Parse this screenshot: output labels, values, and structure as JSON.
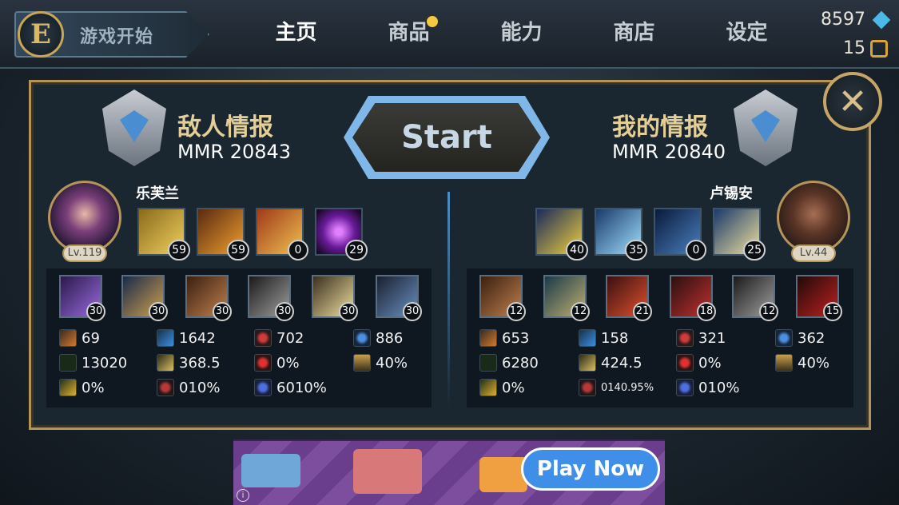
{
  "topbar": {
    "logo_letter": "E",
    "game_start_label": "游戏开始",
    "tabs": [
      {
        "label": "主页",
        "active": true
      },
      {
        "label": "商品",
        "notification": true
      },
      {
        "label": "能力"
      },
      {
        "label": "商店"
      },
      {
        "label": "设定"
      }
    ],
    "gems": "8597",
    "coins": "15"
  },
  "match": {
    "start_label": "Start",
    "close_symbol": "✕",
    "enemy": {
      "title": "敌人情报",
      "mmr": "MMR 20843",
      "name": "乐芙兰",
      "level": "Lv.119",
      "skills": [
        "59",
        "59",
        "0",
        "29"
      ],
      "items": [
        "30",
        "30",
        "30",
        "30",
        "30",
        "30"
      ],
      "stats": {
        "attack_damage": "69",
        "ability_power": "1642",
        "armor": "702",
        "magic_resist": "886",
        "health": "13020",
        "attack_speed": "368.5",
        "crit": "0%",
        "cooldown": "40%",
        "lifesteal": "0%",
        "spell_shield": "010%",
        "mana": "6010%"
      }
    },
    "self": {
      "title": "我的情报",
      "mmr": "MMR 20840",
      "name": "卢锡安",
      "level": "Lv.44",
      "skills": [
        "40",
        "35",
        "0",
        "25"
      ],
      "items": [
        "12",
        "12",
        "21",
        "18",
        "12",
        "15"
      ],
      "stats": {
        "attack_damage": "653",
        "ability_power": "158",
        "armor": "321",
        "magic_resist": "362",
        "health": "6280",
        "attack_speed": "424.5",
        "crit": "0%",
        "cooldown": "40%",
        "lifesteal": "0%",
        "spell_shield": "0140.95%",
        "mana": "010%"
      }
    }
  },
  "ad": {
    "cta": "Play Now",
    "info": "i"
  },
  "colors": {
    "gold_border": "#b3945a",
    "accent_blue": "#7fb8e8",
    "notification_dot": "#f5c842"
  }
}
